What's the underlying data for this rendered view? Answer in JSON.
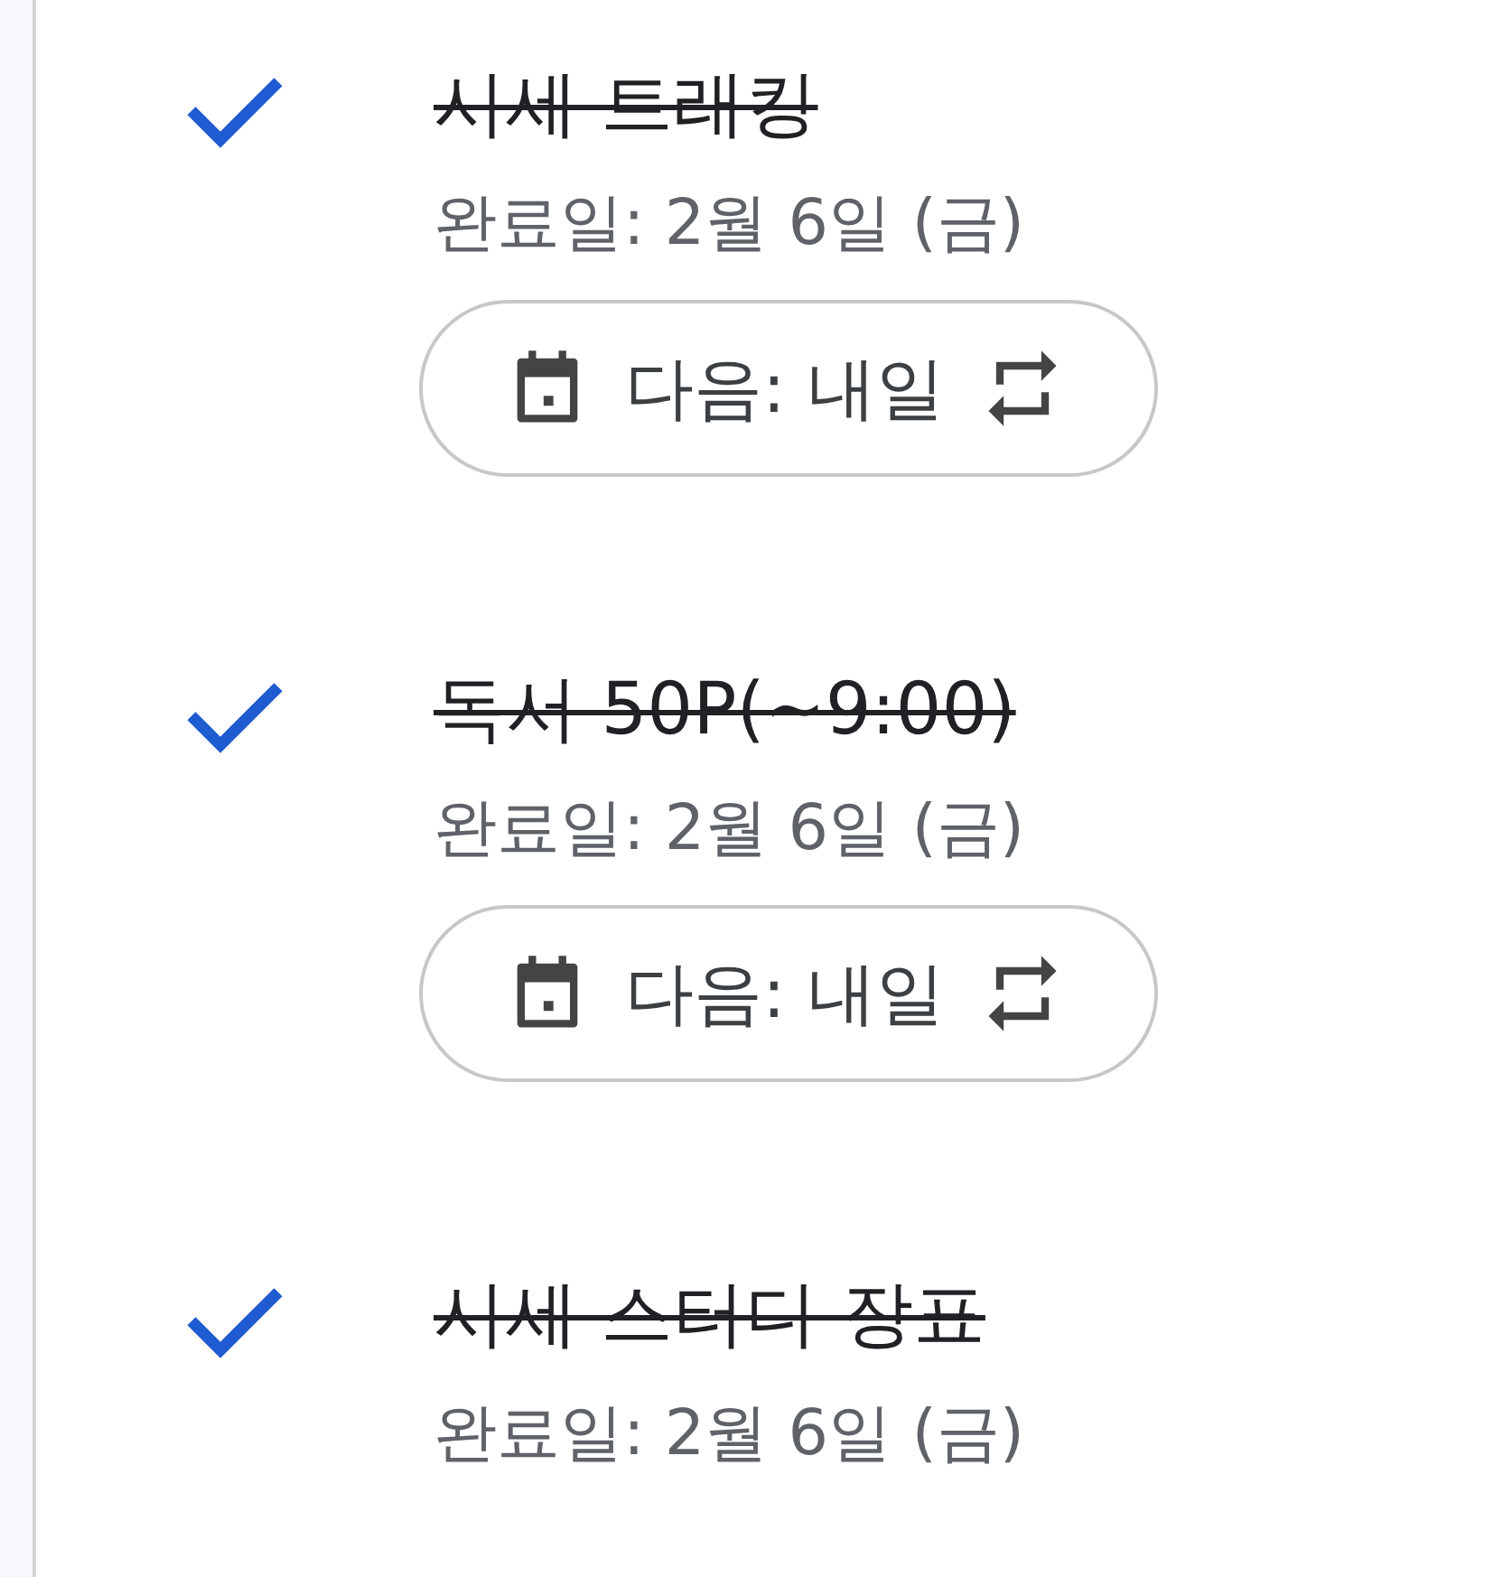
{
  "tasks": [
    {
      "title": "시세 트래킹",
      "completed": true,
      "completed_date": "완료일: 2월 6일 (금)",
      "next": {
        "label": "다음: 내일",
        "repeat": true
      }
    },
    {
      "title": "독서 50P(~9:00)",
      "completed": true,
      "completed_date": "완료일: 2월 6일 (금)",
      "next": {
        "label": "다음: 내일",
        "repeat": true
      }
    },
    {
      "title": "시세 스터디 장표",
      "completed": true,
      "completed_date": "완료일: 2월 6일 (금)"
    }
  ]
}
